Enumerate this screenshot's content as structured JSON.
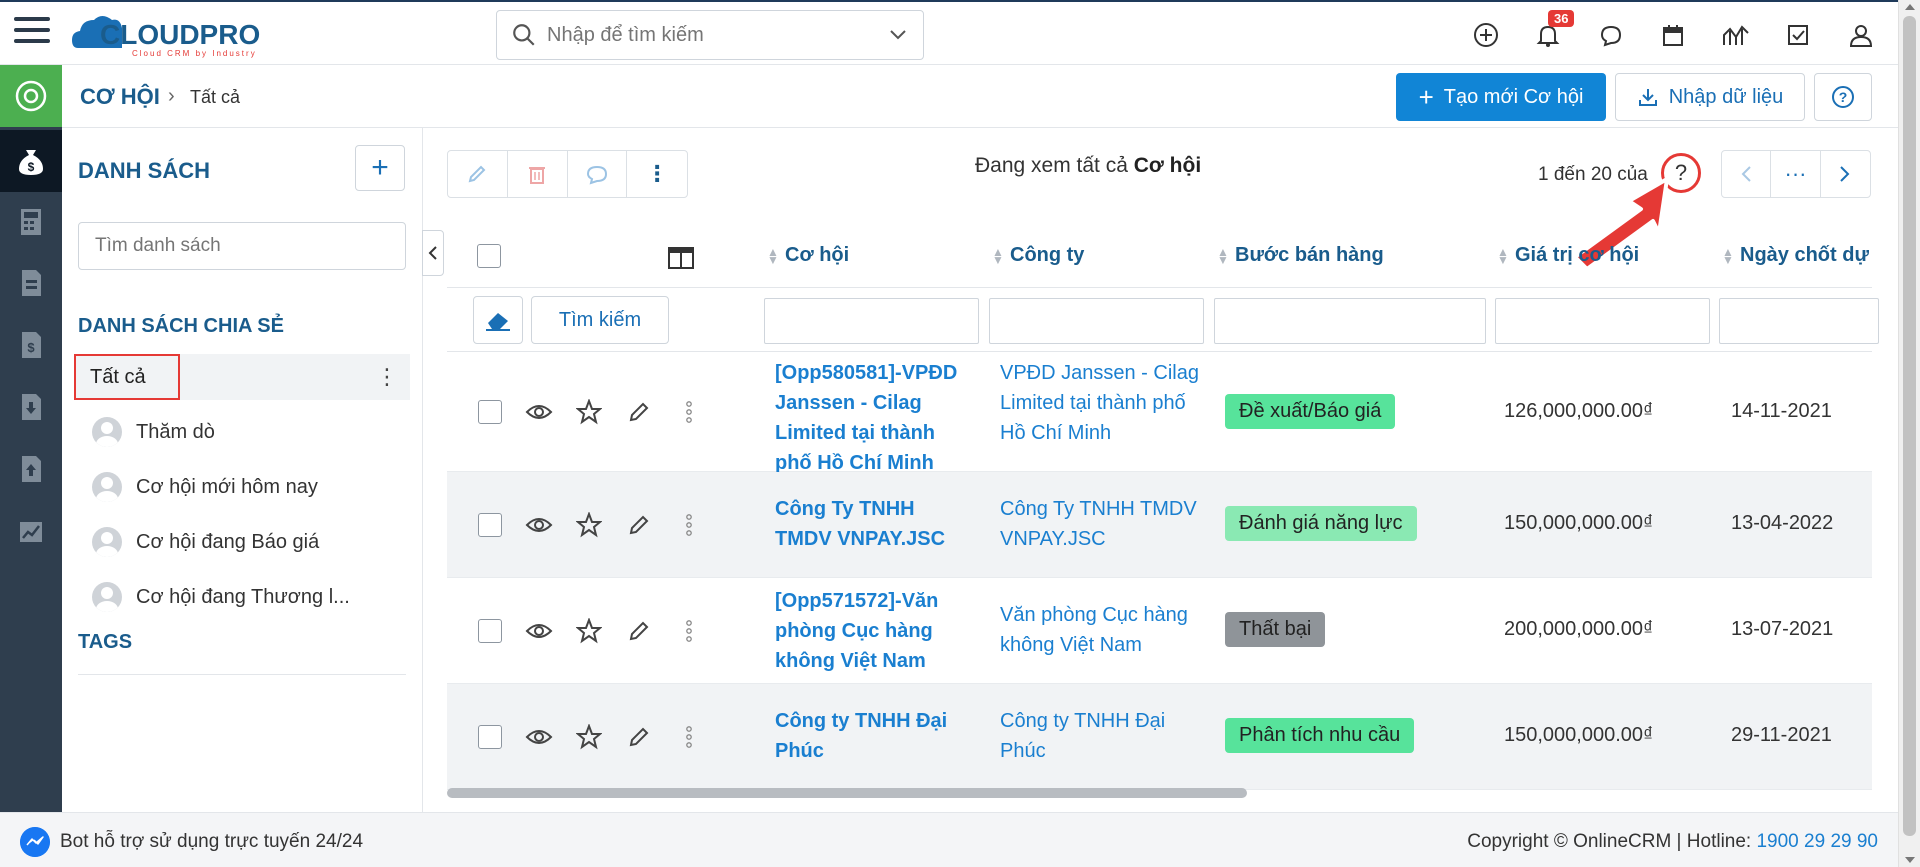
{
  "app": {
    "logo_text": "CLOUDPRO",
    "logo_tagline": "Cloud CRM by Industry"
  },
  "topbar": {
    "search_placeholder": "Nhập để tìm kiếm",
    "notification_count": "36",
    "icons": [
      "plus-circle-icon",
      "bell-icon",
      "chat-icon",
      "calendar-icon",
      "chart-icon",
      "checkbox-icon",
      "user-icon"
    ]
  },
  "breadcrumb": {
    "module": "CƠ HỘI",
    "separator": "›",
    "current": "Tất cả"
  },
  "actions": {
    "create_label": "Tạo mới Cơ hội",
    "import_label": "Nhập dữ liệu"
  },
  "sidebar": {
    "list_title": "DANH SÁCH",
    "search_placeholder": "Tìm danh sách",
    "shared_title": "DANH SÁCH CHIA SẺ",
    "all_label": "Tất cả",
    "items": [
      {
        "label": "Thăm dò"
      },
      {
        "label": "Cơ hội mới hôm nay"
      },
      {
        "label": "Cơ hội đang Báo giá"
      },
      {
        "label": "Cơ hội đang Thương l..."
      }
    ],
    "tags_title": "TAGS"
  },
  "main": {
    "view_prefix": "Đang xem tất cả",
    "view_module": "Cơ hội",
    "pager_text": "1 đến 20 của",
    "pager_q": "?",
    "pager_more": "···",
    "filter_search_label": "Tìm kiếm",
    "columns": [
      "Cơ hội",
      "Công ty",
      "Bước bán hàng",
      "Giá trị cơ hội",
      "Ngày chốt dự"
    ],
    "rows": [
      {
        "opp": "[Opp580581]-VPĐD Janssen - Cilag Limited tại thành phố Hồ Chí Minh",
        "company": "VPĐD Janssen - Cilag Limited tại thành phố Hồ Chí Minh",
        "stage": "Đề xuất/Báo giá",
        "stage_color": "#57e39b",
        "value": "126,000,000.00₫",
        "date": "14-11-2021"
      },
      {
        "opp": "Công Ty TNHH TMDV VNPAY.JSC",
        "company": "Công Ty TNHH TMDV VNPAY.JSC",
        "stage": "Đánh giá năng lực",
        "stage_color": "#8ae9b3",
        "value": "150,000,000.00₫",
        "date": "13-04-2022"
      },
      {
        "opp": "[Opp571572]-Văn phòng Cục hàng không Việt Nam",
        "company": "Văn phòng Cục hàng không Việt Nam",
        "stage": "Thất bại",
        "stage_color": "#8f9499",
        "value": "200,000,000.00₫",
        "date": "13-07-2021"
      },
      {
        "opp": "Công ty TNHH Đại Phúc",
        "company": "Công ty TNHH Đại Phúc",
        "stage": "Phân tích nhu cầu",
        "stage_color": "#57e39b",
        "value": "150,000,000.00₫",
        "date": "29-11-2021"
      }
    ]
  },
  "footer": {
    "bot_text": "Bot hỗ trợ sử dụng trực tuyến 24/24",
    "copyright": "Copyright © OnlineCRM | Hotline:",
    "hotline": "1900 29 29 90"
  },
  "colors": {
    "accent": "#1185d6",
    "link": "#1a7fd0",
    "heading": "#1a5c8c",
    "rail": "#2f3e4e",
    "rail_top": "#4caf50",
    "highlight_red": "#e53935"
  }
}
